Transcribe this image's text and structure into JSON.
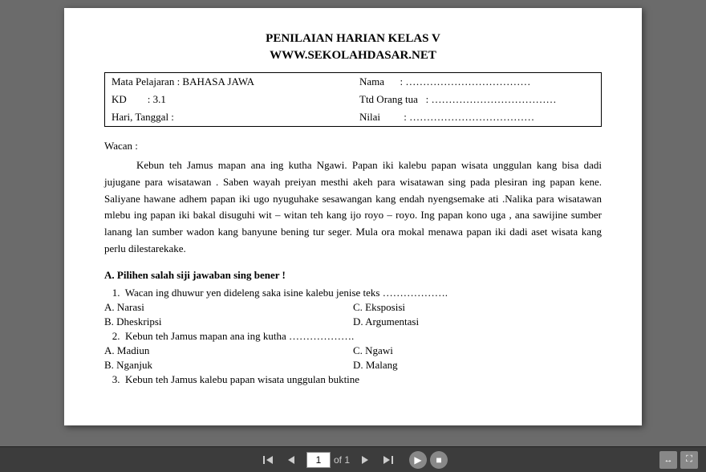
{
  "document": {
    "title_line1": "PENILAIAN HARIAN KELAS V",
    "title_line2": "WWW.SEKOLAHDASAR.NET",
    "info": {
      "mata_pelajaran_label": "Mata Pelajaran : BAHASA JAWA",
      "kd_label": "KD",
      "kd_value": ": 3.1",
      "hari_label": "Hari, Tanggal :",
      "nama_label": "Nama",
      "nama_dots": ": ………………………………",
      "ttd_label": "Ttd Orang tua",
      "ttd_dots": ": ………………………………",
      "nilai_label": "Nilai",
      "nilai_dots": ": ………………………………"
    },
    "wacan_label": "Wacan :",
    "wacan_paragraph": "Kebun teh Jamus mapan ana ing kutha Ngawi. Papan iki kalebu papan wisata unggulan kang bisa dadi jujugane para wisatawan . Saben wayah preiyan mesthi akeh para wisatawan sing pada plesiran ing papan kene. Saliyane hawane adhem papan iki ugo nyuguhake sesawangan kang endah nyengsemake ati .Nalika para wisatawan mlebu ing papan iki bakal disuguhi wit – witan teh kang ijo royo – royo. Ing papan kono uga , ana sawijine sumber lanang lan sumber wadon kang banyune bening tur seger. Mula ora mokal menawa papan iki dadi aset wisata kang perlu dilestarekake.",
    "section_a_title": "A. Pilihen salah siji jawaban sing bener !",
    "questions": [
      {
        "number": "1.",
        "text": "Wacan ing dhuwur yen dideleng saka isine kalebu jenise teks ………………."
      },
      {
        "number": "2.",
        "text": "Kebun teh Jamus mapan ana ing kutha ………………."
      },
      {
        "number": "3.",
        "text": "Kebun teh Jamus kalebu papan wisata unggulan buktine"
      }
    ],
    "q1_answers": {
      "a": "A. Narasi",
      "b": "B. Dheskripsi",
      "c": "C. Eksposisi",
      "d": "D. Argumentasi"
    },
    "q2_answers": {
      "a": "A. Madiun",
      "b": "B. Nganjuk",
      "c": "C. Ngawi",
      "d": "D. Malang"
    }
  },
  "toolbar": {
    "page_current": "1",
    "page_total": "of 1",
    "first_label": "⏮",
    "prev_label": "◀",
    "next_label": "▶",
    "last_label": "⏭",
    "play_label": "▶",
    "stop_label": "⏹"
  }
}
